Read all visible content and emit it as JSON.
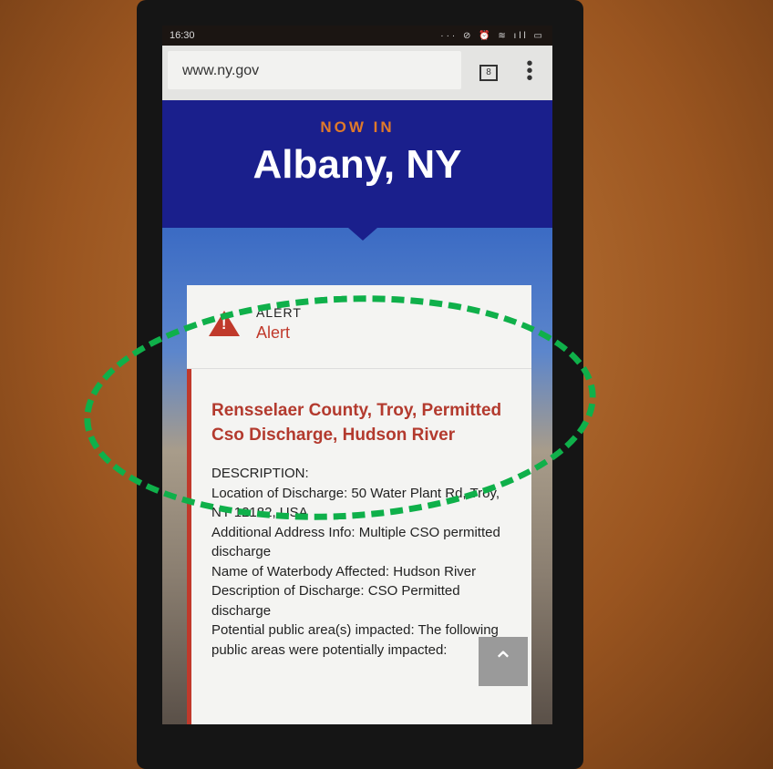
{
  "status_bar": {
    "time": "16:30",
    "icons": "··· ⊘ ⏰ ≋ ıll ▭"
  },
  "browser": {
    "url": "www.ny.gov",
    "tab_count": "8",
    "menu": "⋮"
  },
  "hero": {
    "kicker": "NOW IN",
    "city": "Albany, NY"
  },
  "alert": {
    "category": "ALERT",
    "type": "Alert",
    "title": "Rensselaer County, Troy, Permitted Cso Discharge, Hudson River",
    "description": [
      "DESCRIPTION:",
      "Location of Discharge: 50 Water Plant Rd, Troy, NY 12182, USA",
      "Additional Address Info: Multiple CSO permitted discharge",
      "Name of Waterbody Affected: Hudson River",
      "Description of Discharge: CSO Permitted discharge",
      "Potential public area(s) impacted: The following public areas were potentially impacted:"
    ]
  },
  "scroll_top": "⌃"
}
